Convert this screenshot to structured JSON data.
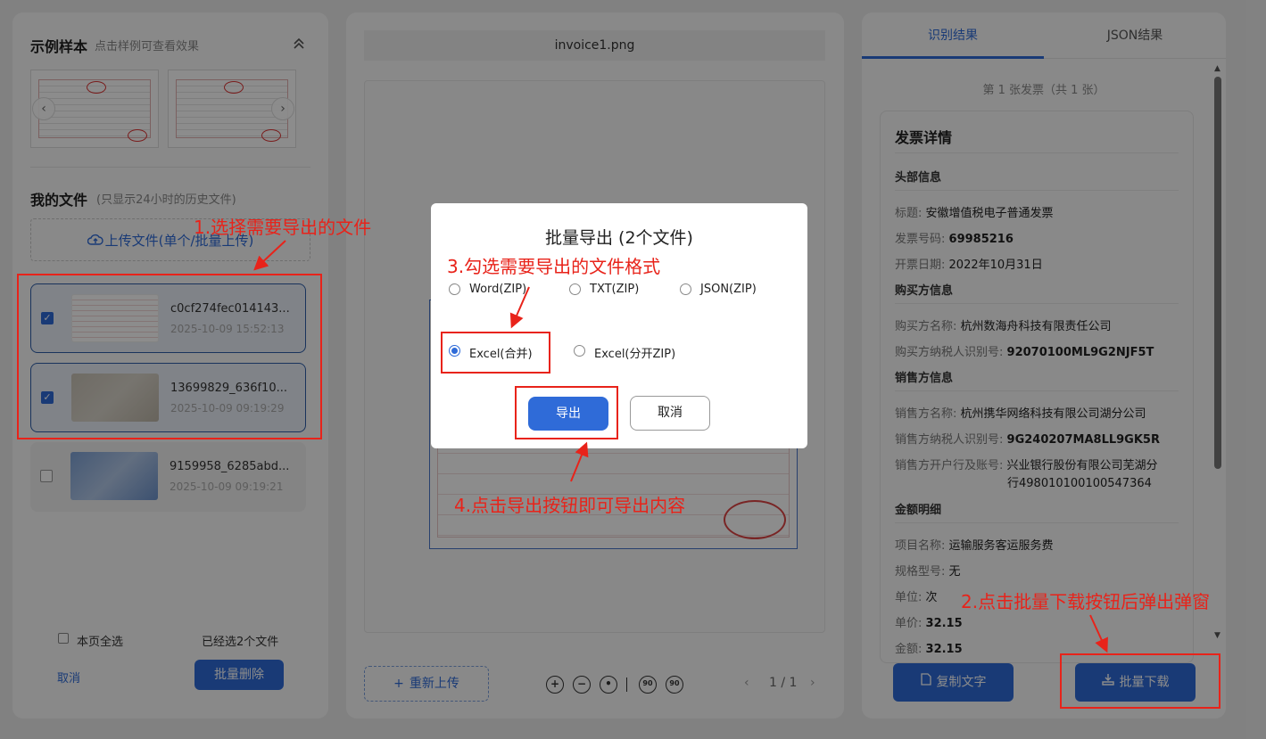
{
  "left": {
    "samples_title": "示例样本",
    "samples_hint": "点击样例可查看效果",
    "collapse_icon": "chevron-double-up",
    "my_files_title": "我的文件",
    "my_files_hint": "(只显示24小时的历史文件)",
    "upload_label": "上传文件(单个/批量上传)",
    "files": [
      {
        "name": "c0cf274fec014143...",
        "time": "2025-10-09 15:52:13",
        "checked": true
      },
      {
        "name": "13699829_636f10...",
        "time": "2025-10-09 09:19:29",
        "checked": true
      },
      {
        "name": "9159958_6285abd...",
        "time": "2025-10-09 09:19:21",
        "checked": false
      }
    ],
    "select_all_label": "本页全选",
    "selected_count": "已经选2个文件",
    "cancel_label": "取消",
    "batch_delete_label": "批量删除"
  },
  "center": {
    "file_title": "invoice1.png",
    "reupload_label": "重新上传",
    "rotate_left_label": "90",
    "rotate_right_label": "90",
    "page_indicator": "1 / 1"
  },
  "right": {
    "tabs": [
      "识别结果",
      "JSON结果"
    ],
    "counter": "第 1 张发票（共 1 张）",
    "detail_title": "发票详情",
    "sections": {
      "header": "头部信息",
      "buyer": "购买方信息",
      "seller": "销售方信息",
      "amount": "金额明细"
    },
    "fields": {
      "title_k": "标题:",
      "title_v": "安徽增值税电子普通发票",
      "number_k": "发票号码:",
      "number_v": "69985216",
      "date_k": "开票日期:",
      "date_v": "2022年10月31日",
      "buyer_name_k": "购买方名称:",
      "buyer_name_v": "杭州数海舟科技有限责任公司",
      "buyer_tax_k": "购买方纳税人识别号:",
      "buyer_tax_v": "92070100ML9G2NJF5T",
      "seller_name_k": "销售方名称:",
      "seller_name_v": "杭州携华网络科技有限公司湖分公司",
      "seller_tax_k": "销售方纳税人识别号:",
      "seller_tax_v": "9G240207MA8LL9GK5R",
      "seller_bank_k": "销售方开户行及账号:",
      "seller_bank_v1": "兴业银行股份有限公司芜湖分",
      "seller_bank_v2": "行498010100100547364",
      "item_k": "项目名称:",
      "item_v": "运输服务客运服务费",
      "spec_k": "规格型号:",
      "spec_v": "无",
      "unit_k": "单位:",
      "unit_v": "次",
      "price_k": "单价:",
      "price_v": "32.15",
      "amount_k": "金额:",
      "amount_v": "32.15"
    },
    "copy_label": "复制文字",
    "batch_download_label": "批量下载"
  },
  "modal": {
    "title": "批量导出 (2个文件)",
    "options": [
      {
        "label": "Word(ZIP)",
        "selected": false
      },
      {
        "label": "TXT(ZIP)",
        "selected": false
      },
      {
        "label": "JSON(ZIP)",
        "selected": false
      },
      {
        "label": "Excel(合并)",
        "selected": true
      },
      {
        "label": "Excel(分开ZIP)",
        "selected": false
      }
    ],
    "export_label": "导出",
    "cancel_label": "取消"
  },
  "annotations": {
    "step1": "1.选择需要导出的文件",
    "step2": "2.点击批量下载按钮后弹出弹窗",
    "step3": "3.勾选需要导出的文件格式",
    "step4": "4.点击导出按钮即可导出内容",
    "color": "#e8231a"
  },
  "colors": {
    "accent": "#2f6bd8",
    "overlay": "rgba(0,0,0,0.45)"
  }
}
